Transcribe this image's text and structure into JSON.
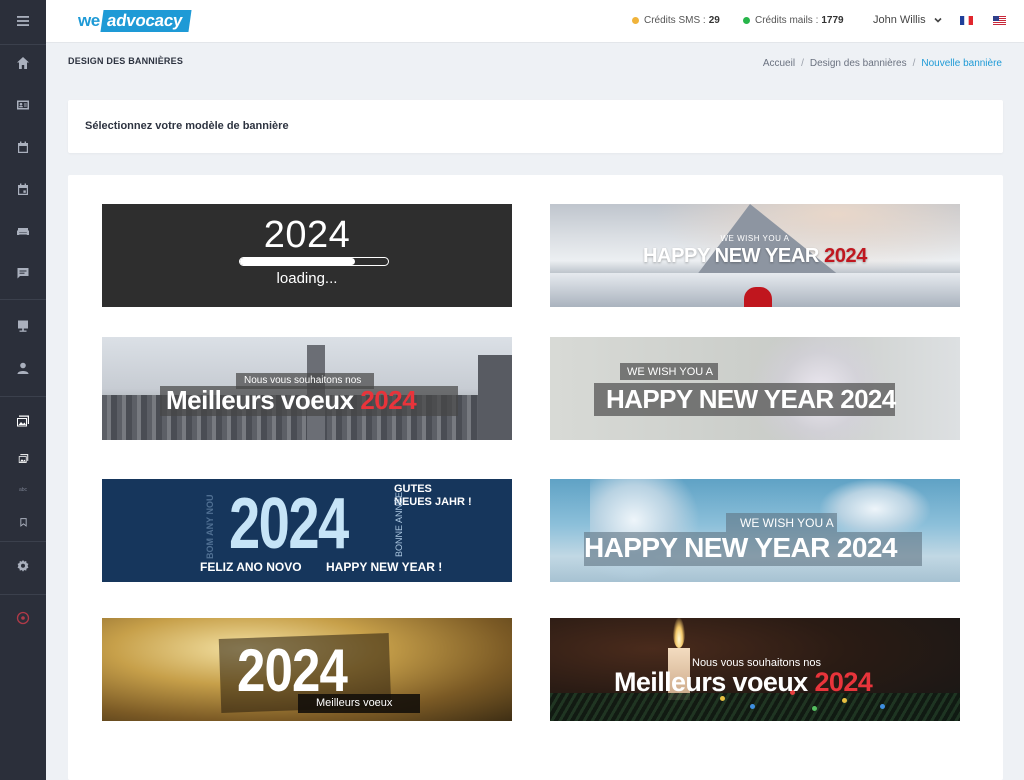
{
  "header": {
    "logo": {
      "we": "we",
      "advocacy": "advocacy"
    },
    "credits_sms": {
      "label": "Crédits SMS :",
      "value": "29",
      "color": "#f0b33a"
    },
    "credits_mails": {
      "label": "Crédits mails :",
      "value": "1779",
      "color": "#27b54a"
    },
    "user_name": "John Willis",
    "languages": [
      "fr-flag",
      "us-flag"
    ]
  },
  "sidebar": {
    "items": [
      "menu-icon",
      "home-icon",
      "contact-card-icon",
      "calendar-icon",
      "calendar-event-icon",
      "sofa-icon",
      "chat-icon",
      "monitor-icon",
      "person-icon",
      "images-icon",
      "image-icon",
      "abc-icon",
      "bookmark-icon",
      "gear-icon",
      "target-icon"
    ],
    "tiny_label": "abc"
  },
  "page": {
    "title": "DESIGN DES BANNIÈRES",
    "breadcrumb": [
      "Accueil",
      "Design des bannières",
      "Nouvelle bannière"
    ]
  },
  "select_card": {
    "label": "Sélectionnez votre modèle de bannière"
  },
  "banners": {
    "b1": {
      "year": "2024",
      "loading": "loading...",
      "progress": 0.78
    },
    "b2": {
      "small": "WE WISH YOU A",
      "big": "HAPPY NEW YEAR",
      "year": "2024"
    },
    "b3": {
      "small": "Nous vous souhaitons nos",
      "big": "Meilleurs voeux",
      "year": "2024"
    },
    "b4": {
      "small": "WE WISH YOU A",
      "big": "HAPPY NEW YEAR 2024"
    },
    "b5": {
      "year": "2024",
      "gutes": "GUTES",
      "neues": "NEUES JAHR !",
      "bonne": "BONNE ANNÉE",
      "vertical": "BOM ANY NOU",
      "feliz": "FELIZ ANO NOVO",
      "happy": "HAPPY NEW YEAR !"
    },
    "b6": {
      "small": "WE WISH YOU A",
      "big": "HAPPY NEW YEAR 2024"
    },
    "b7": {
      "year": "2024",
      "small": "Meilleurs voeux"
    },
    "b8": {
      "small": "Nous vous souhaitons nos",
      "big": "Meilleurs voeux",
      "year": "2024"
    }
  },
  "colors": {
    "accent": "#1e9ad6",
    "sidebar": "#2b2f3a",
    "red_highlight": "#e8343b"
  }
}
